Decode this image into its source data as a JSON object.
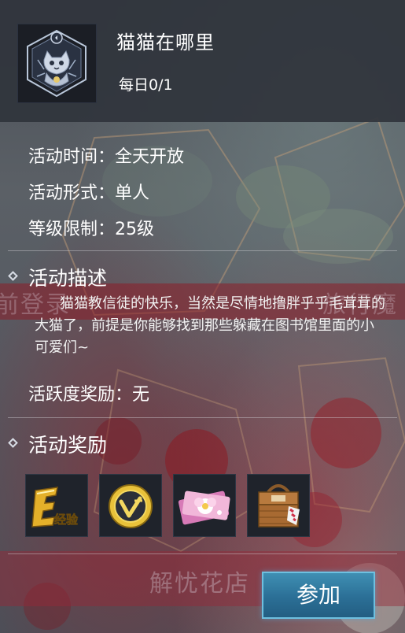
{
  "header": {
    "title": "猫猫在哪里",
    "daily": "每日0/1"
  },
  "info": {
    "time_label": "活动时间：",
    "time_value": "全天开放",
    "form_label": "活动形式：",
    "form_value": "单人",
    "level_label": "等级限制：",
    "level_value": "25级"
  },
  "description": {
    "heading": "活动描述",
    "text": "猫猫教信徒的快乐，当然是尽情地撸胖乎乎毛茸茸的大猫了，前提是你能够找到那些躲藏在图书馆里面的小可爱们~",
    "activity_reward_label": "活跃度奖励：",
    "activity_reward_value": "无"
  },
  "rewards": {
    "heading": "活动奖励",
    "items": [
      {
        "icon": "exp-icon",
        "label": "经验"
      },
      {
        "icon": "coin-icon"
      },
      {
        "icon": "flower-card-icon"
      },
      {
        "icon": "basket-icon"
      }
    ]
  },
  "background_text": {
    "left": "前登录",
    "right": "旅行魔",
    "bottom": "解忧花店"
  },
  "join_button": "参加",
  "colors": {
    "button_accent": "#2b6f96",
    "text": "#ffffff"
  }
}
